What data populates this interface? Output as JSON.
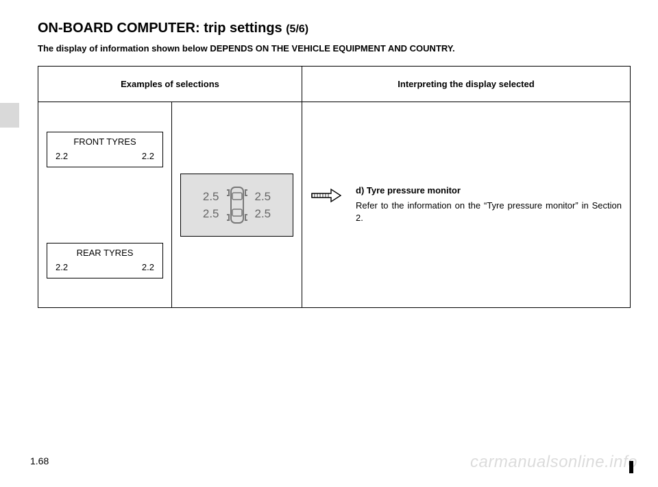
{
  "title_main": "ON-BOARD COMPUTER: trip settings ",
  "title_sub": "(5/6)",
  "note": "The display of information shown below DEPENDS ON THE VEHICLE EQUIPMENT AND COUNTRY.",
  "table": {
    "header_left": "Examples of selections",
    "header_right": "Interpreting the display selected",
    "front": {
      "label": "FRONT TYRES",
      "left": "2.2",
      "right": "2.2"
    },
    "rear": {
      "label": "REAR TYRES",
      "left": "2.2",
      "right": "2.2"
    },
    "graphic": {
      "fl": "2.5",
      "fr": "2.5",
      "rl": "2.5",
      "rr": "2.5"
    },
    "interp": {
      "heading": "d) Tyre pressure monitor",
      "body": "Refer to the information on the “Tyre pressure monitor” in Section 2."
    }
  },
  "page_number": "1.68",
  "watermark": "carmanualsonline.info"
}
